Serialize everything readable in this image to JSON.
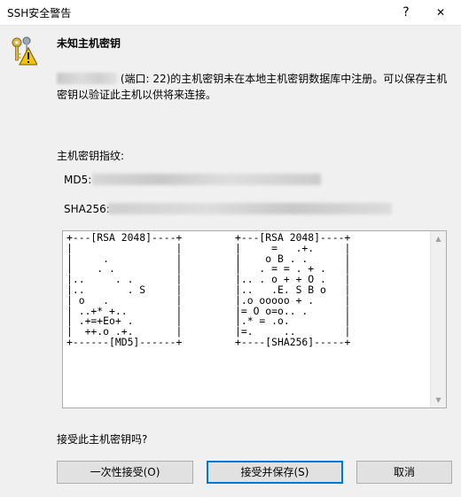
{
  "window": {
    "title": "SSH安全警告",
    "help_glyph": "?",
    "close_glyph": "✕"
  },
  "dialog": {
    "heading": "未知主机密钥",
    "message_line1": " (端口: 22)的主机密钥未在本地主机密钥数据库中注册。可以保存主机",
    "message_line2": "密钥以验证此主机以供将来连接。",
    "fingerprint_label": "主机密钥指纹:",
    "md5_label": "MD5:",
    "sha256_label": "SHA256:",
    "randomart_md5": "+---[RSA 2048]----+\n|                 |\n|     .           |\n|    . .          |\n|..     . .       |\n|..       . S     |\n| o   .           |\n| ..+* +..        |\n| .+=+Eo+ .       |\n|  ++.o .+.       |\n+------[MD5]------+",
    "randomart_sha256": "+---[RSA 2048]----+\n|     =   .+.     |\n|    o B . .      |\n|   . = = . + .   |\n|.. . o + + O .   |\n|..   .E. S B o   |\n|.o ooooo + .     |\n|= O o=o.. .      |\n|.* = .o.         |\n|=.     ..        |\n+----[SHA256]-----+",
    "question": "接受此主机密钥吗?",
    "icon": "keys-warning-icon"
  },
  "buttons": {
    "accept_once": "一次性接受(O)",
    "accept_save": "接受并保存(S)",
    "cancel": "取消"
  },
  "colors": {
    "background": "#f0f0f0",
    "focus_border": "#0078d7",
    "button_face": "#e1e1e1"
  }
}
